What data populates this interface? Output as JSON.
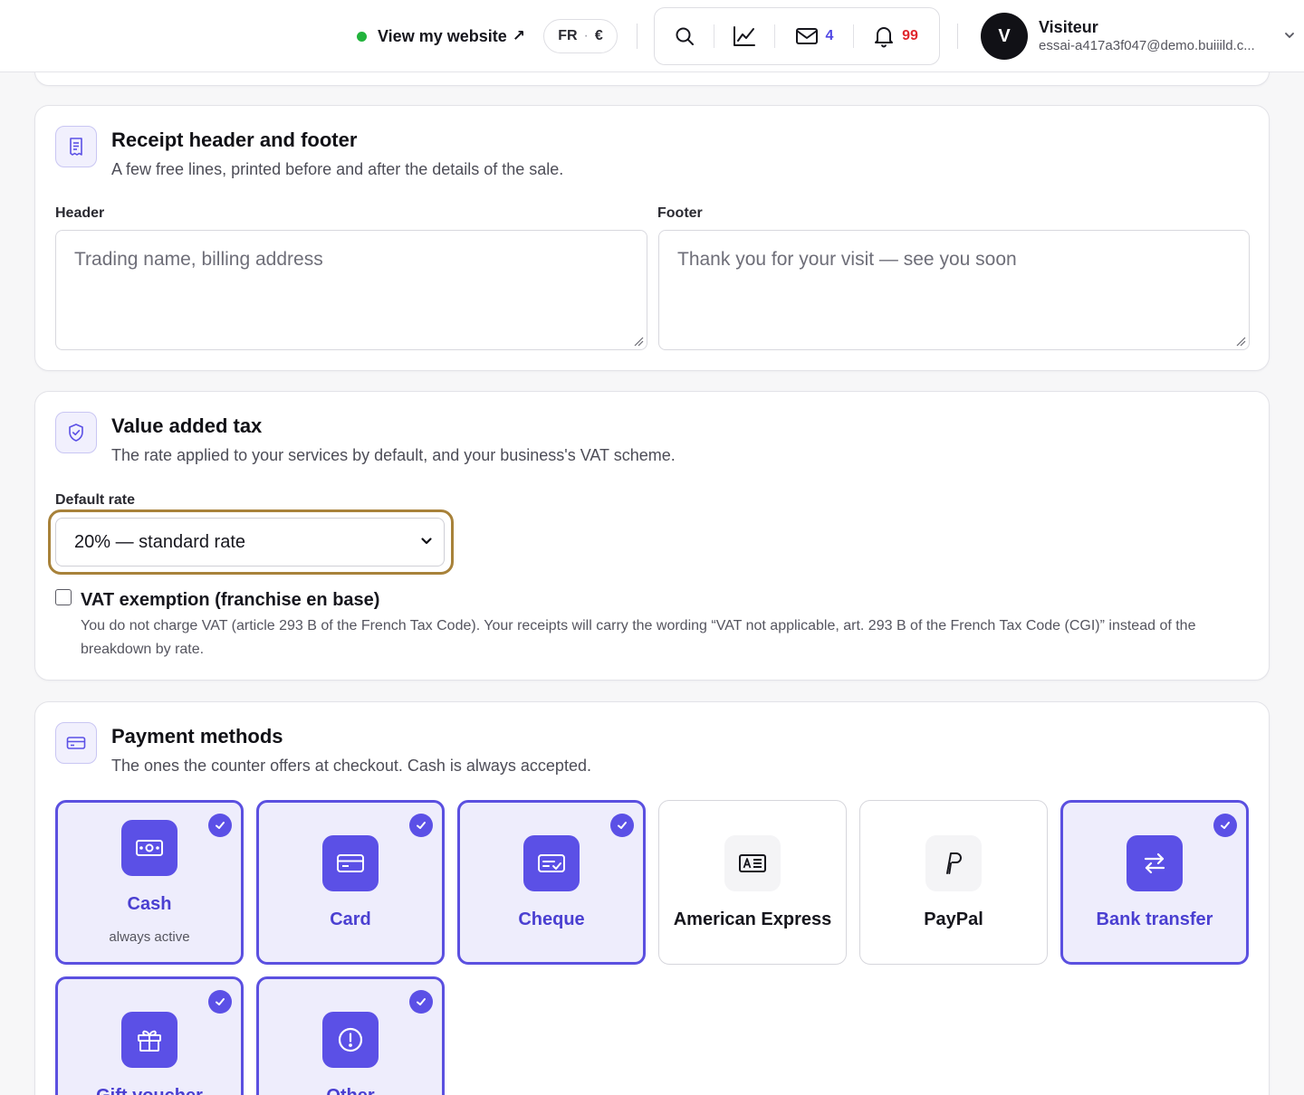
{
  "topbar": {
    "site_link": "View my website",
    "site_link_arrow": "↗",
    "locale": {
      "lang": "FR",
      "separator": "·",
      "currency": "€"
    },
    "messages_count": "4",
    "notifications_count": "99",
    "user": {
      "initial": "V",
      "name": "Visiteur",
      "email": "essai-a417a3f047@demo.buiiild.c..."
    }
  },
  "receipt": {
    "title": "Receipt header and footer",
    "subtitle": "A few free lines, printed before and after the details of the sale.",
    "header_label": "Header",
    "header_placeholder": "Trading name, billing address",
    "footer_label": "Footer",
    "footer_placeholder": "Thank you for your visit — see you soon"
  },
  "vat": {
    "title": "Value added tax",
    "subtitle": "The rate applied to your services by default, and your business's VAT scheme.",
    "rate_label": "Default rate",
    "rate_value": "20% — standard rate",
    "exemption_checked": false,
    "exemption_label": "VAT exemption (franchise en base)",
    "exemption_help": "You do not charge VAT (article 293 B of the French Tax Code). Your receipts will carry the wording “VAT not applicable, art. 293 B of the French Tax Code (CGI)” instead of the breakdown by rate."
  },
  "payment": {
    "title": "Payment methods",
    "subtitle": "The ones the counter offers at checkout. Cash is always accepted.",
    "methods": [
      {
        "label": "Cash",
        "note": "always active",
        "selected": true,
        "icon": "cash-icon"
      },
      {
        "label": "Card",
        "selected": true,
        "icon": "card-icon"
      },
      {
        "label": "Cheque",
        "selected": true,
        "icon": "cheque-icon"
      },
      {
        "label": "American Express",
        "selected": false,
        "icon": "amex-icon"
      },
      {
        "label": "PayPal",
        "selected": false,
        "icon": "paypal-icon"
      },
      {
        "label": "Bank transfer",
        "selected": true,
        "icon": "transfer-icon"
      },
      {
        "label": "Gift voucher",
        "selected": true,
        "icon": "gift-icon"
      },
      {
        "label": "Other",
        "selected": true,
        "icon": "other-icon"
      }
    ]
  },
  "colors": {
    "accent": "#5b50e6",
    "focus_ring": "#a8823a",
    "online_dot": "#22b33c",
    "notification_badge": "#e0262d",
    "message_badge": "#4f46e5"
  }
}
